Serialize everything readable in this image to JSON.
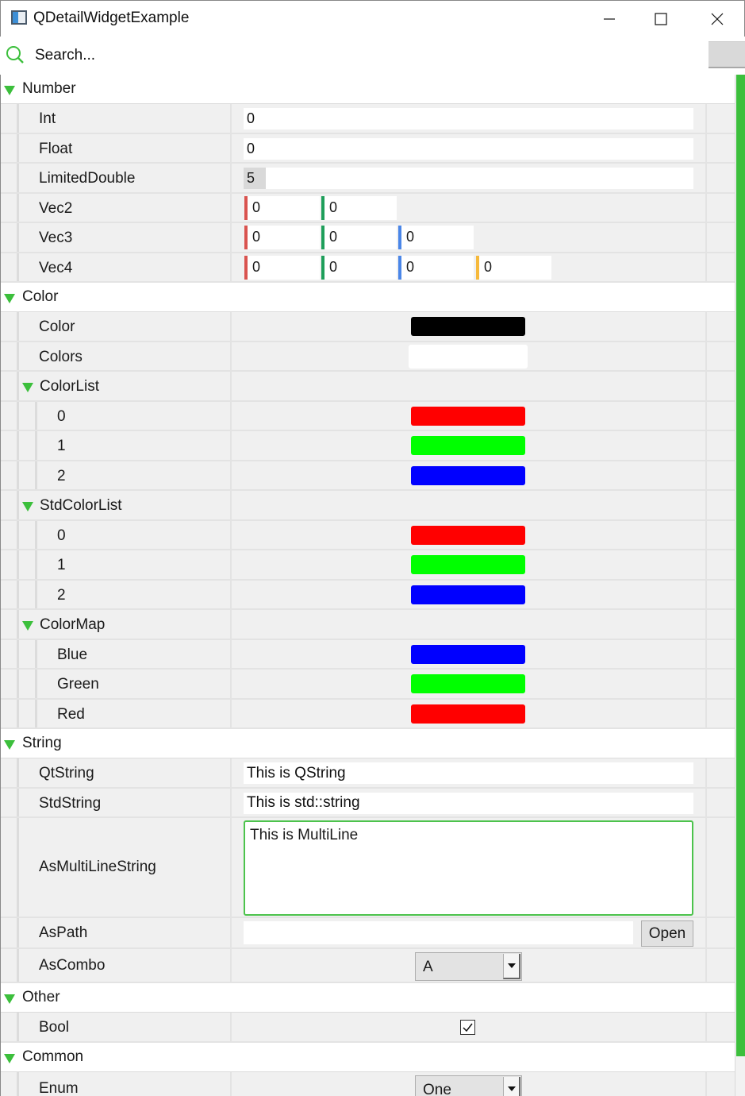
{
  "window": {
    "title": "QDetailWidgetExample"
  },
  "search": {
    "placeholder": "Search..."
  },
  "colors": {
    "accent": "#3cbf3c",
    "vec_x": "#d9534f",
    "vec_y": "#1e9e5a",
    "vec_z": "#4a86e8",
    "vec_w": "#f6b93b"
  },
  "number": {
    "title": "Number",
    "int": {
      "label": "Int",
      "value": "0"
    },
    "float": {
      "label": "Float",
      "value": "0"
    },
    "limited": {
      "label": "LimitedDouble",
      "value": "5",
      "fill_fraction": 0.05
    },
    "vec2": {
      "label": "Vec2",
      "values": [
        "0",
        "0"
      ]
    },
    "vec3": {
      "label": "Vec3",
      "values": [
        "0",
        "0",
        "0"
      ]
    },
    "vec4": {
      "label": "Vec4",
      "values": [
        "0",
        "0",
        "0",
        "0"
      ]
    }
  },
  "color": {
    "title": "Color",
    "color": {
      "label": "Color",
      "value": "#000000"
    },
    "colors": {
      "label": "Colors"
    },
    "colorlist": {
      "label": "ColorList",
      "items": [
        {
          "key": "0",
          "color": "#ff0000"
        },
        {
          "key": "1",
          "color": "#00ff00"
        },
        {
          "key": "2",
          "color": "#0000ff"
        }
      ]
    },
    "stdcolorlist": {
      "label": "StdColorList",
      "items": [
        {
          "key": "0",
          "color": "#ff0000"
        },
        {
          "key": "1",
          "color": "#00ff00"
        },
        {
          "key": "2",
          "color": "#0000ff"
        }
      ]
    },
    "colormap": {
      "label": "ColorMap",
      "items": [
        {
          "key": "Blue",
          "color": "#0000ff"
        },
        {
          "key": "Green",
          "color": "#00ff00"
        },
        {
          "key": "Red",
          "color": "#ff0000"
        }
      ]
    }
  },
  "string": {
    "title": "String",
    "qtstring": {
      "label": "QtString",
      "value": "This is QString"
    },
    "stdstring": {
      "label": "StdString",
      "value": "This is std::string"
    },
    "multiline": {
      "label": "AsMultiLineString",
      "value": "This is MultiLine"
    },
    "aspath": {
      "label": "AsPath",
      "value": "",
      "button": "Open"
    },
    "ascombo": {
      "label": "AsCombo",
      "value": "A"
    }
  },
  "other": {
    "title": "Other",
    "bool": {
      "label": "Bool",
      "checked": true
    }
  },
  "common": {
    "title": "Common",
    "enum": {
      "label": "Enum",
      "value": "One"
    }
  }
}
